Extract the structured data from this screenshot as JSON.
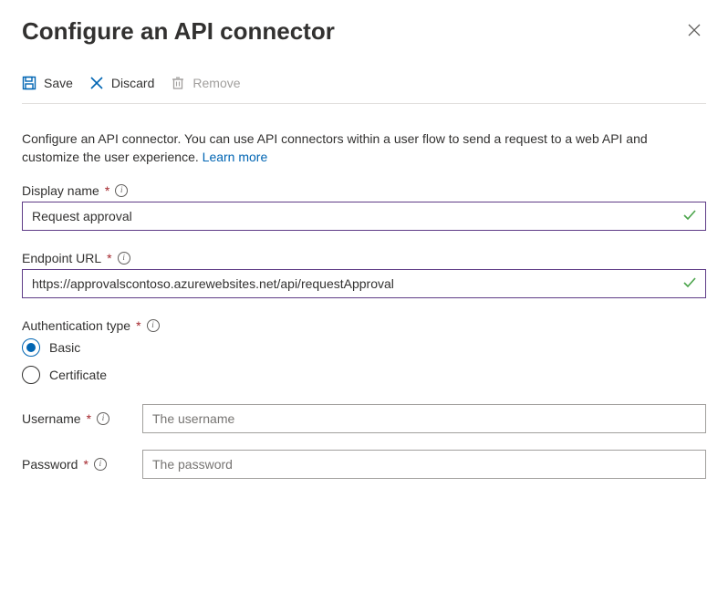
{
  "header": {
    "title": "Configure an API connector"
  },
  "toolbar": {
    "save": "Save",
    "discard": "Discard",
    "remove": "Remove"
  },
  "intro": {
    "text": "Configure an API connector. You can use API connectors within a user flow to send a request to a web API and customize the user experience. ",
    "link": "Learn more"
  },
  "fields": {
    "displayName": {
      "label": "Display name",
      "value": "Request approval"
    },
    "endpointUrl": {
      "label": "Endpoint URL",
      "value": "https://approvalscontoso.azurewebsites.net/api/requestApproval"
    },
    "authType": {
      "label": "Authentication type",
      "options": {
        "basic": "Basic",
        "certificate": "Certificate"
      },
      "selected": "basic"
    },
    "username": {
      "label": "Username",
      "placeholder": "The username",
      "value": ""
    },
    "password": {
      "label": "Password",
      "placeholder": "The password",
      "value": ""
    }
  }
}
